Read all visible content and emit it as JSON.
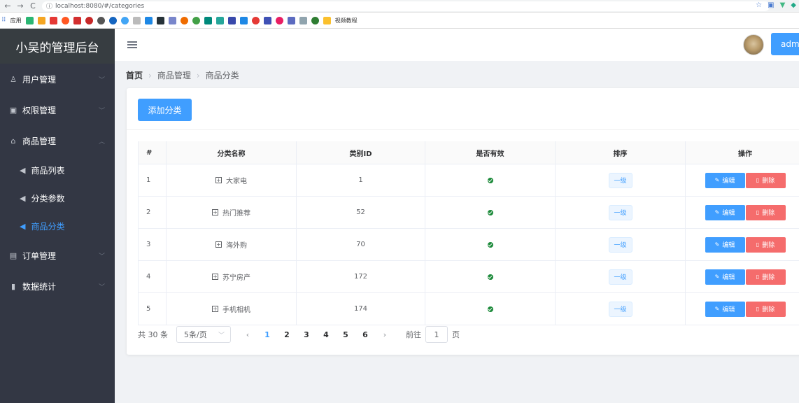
{
  "browser": {
    "url": "localhost:8080/#/categories",
    "bookmark_label": "视频教程",
    "apps_label": "应用"
  },
  "sidebar": {
    "brand": "小吴的管理后台",
    "menus": [
      {
        "label": "用户管理",
        "icon": "user-icon"
      },
      {
        "label": "权限管理",
        "icon": "lock-icon"
      },
      {
        "label": "商品管理",
        "icon": "bag-icon"
      }
    ],
    "sub_items": [
      {
        "label": "商品列表"
      },
      {
        "label": "分类参数"
      },
      {
        "label": "商品分类"
      }
    ],
    "menus_after": [
      {
        "label": "订单管理",
        "icon": "order-icon"
      },
      {
        "label": "数据统计",
        "icon": "chart-icon"
      }
    ]
  },
  "header": {
    "username_btn": "adm"
  },
  "breadcrumb": {
    "home": "首页",
    "level1": "商品管理",
    "level2": "商品分类"
  },
  "card": {
    "add_button": "添加分类"
  },
  "table": {
    "columns": [
      "#",
      "分类名称",
      "类别ID",
      "是否有效",
      "排序",
      "操作"
    ],
    "rows": [
      {
        "index": "1",
        "name": "大家电",
        "id": "1",
        "level": "一级"
      },
      {
        "index": "2",
        "name": "热门推荐",
        "id": "52",
        "level": "一级"
      },
      {
        "index": "3",
        "name": "海外购",
        "id": "70",
        "level": "一级"
      },
      {
        "index": "4",
        "name": "苏宁房产",
        "id": "172",
        "level": "一级"
      },
      {
        "index": "5",
        "name": "手机相机",
        "id": "174",
        "level": "一级"
      }
    ],
    "edit_label": "编辑",
    "delete_label": "删除"
  },
  "pagination": {
    "total": "共 30 条",
    "page_size": "5条/页",
    "pages": [
      "1",
      "2",
      "3",
      "4",
      "5",
      "6"
    ],
    "current_page": "1",
    "goto_label": "前往",
    "goto_value": "1",
    "goto_unit": "页"
  },
  "colors": {
    "primary": "#409eff",
    "danger": "#f56c6c",
    "sidebar_bg": "#333744",
    "success": "#1c8a3a"
  }
}
